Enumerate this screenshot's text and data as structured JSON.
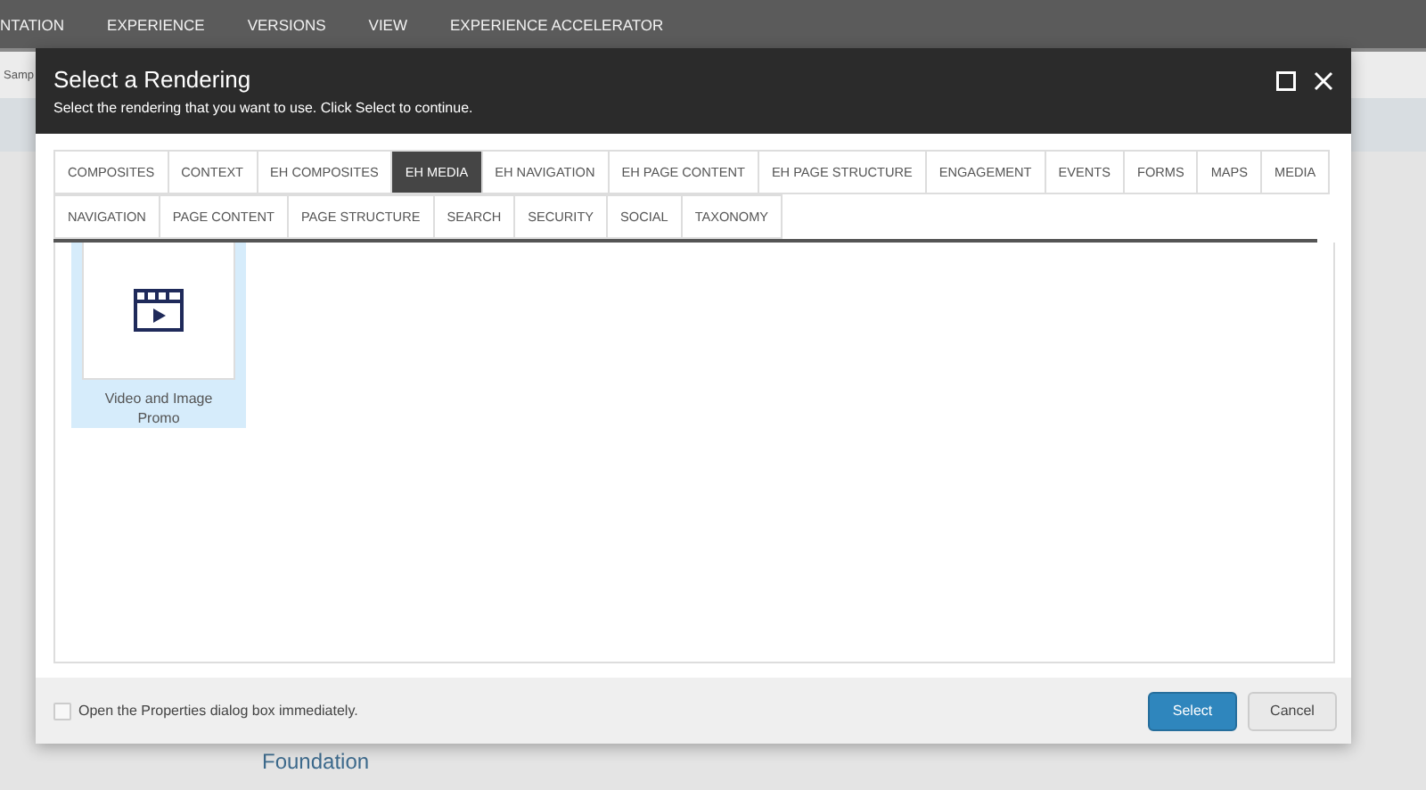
{
  "nav": [
    "NTATION",
    "EXPERIENCE",
    "VERSIONS",
    "VIEW",
    "EXPERIENCE ACCELERATOR"
  ],
  "page": {
    "breadcrumb": "Samp",
    "footer_text": "Foundation"
  },
  "dialog": {
    "title": "Select a Rendering",
    "subtitle": "Select the rendering that you want to use. Click Select to continue.",
    "tab_rows": [
      [
        {
          "label": "COMPOSITES",
          "selected": false
        },
        {
          "label": "CONTEXT",
          "selected": false
        },
        {
          "label": "EH COMPOSITES",
          "selected": false
        },
        {
          "label": "EH MEDIA",
          "selected": true
        },
        {
          "label": "EH NAVIGATION",
          "selected": false
        },
        {
          "label": "EH PAGE CONTENT",
          "selected": false
        },
        {
          "label": "EH PAGE STRUCTURE",
          "selected": false
        },
        {
          "label": "ENGAGEMENT",
          "selected": false
        },
        {
          "label": "EVENTS",
          "selected": false
        },
        {
          "label": "FORMS",
          "selected": false
        },
        {
          "label": "MAPS",
          "selected": false
        },
        {
          "label": "MEDIA",
          "selected": false
        }
      ],
      [
        {
          "label": "NAVIGATION",
          "selected": false
        },
        {
          "label": "PAGE CONTENT",
          "selected": false
        },
        {
          "label": "PAGE STRUCTURE",
          "selected": false
        },
        {
          "label": "SEARCH",
          "selected": false
        },
        {
          "label": "SECURITY",
          "selected": false
        },
        {
          "label": "SOCIAL",
          "selected": false
        },
        {
          "label": "TAXONOMY",
          "selected": false
        }
      ]
    ],
    "renderings": [
      {
        "name": "Video and Image Promo",
        "selected": true
      }
    ],
    "open_properties": {
      "label": "Open the Properties dialog box immediately.",
      "checked": false
    },
    "buttons": [
      {
        "label": "Select",
        "kind": "primary"
      },
      {
        "label": "Cancel",
        "kind": "secondary"
      }
    ]
  }
}
